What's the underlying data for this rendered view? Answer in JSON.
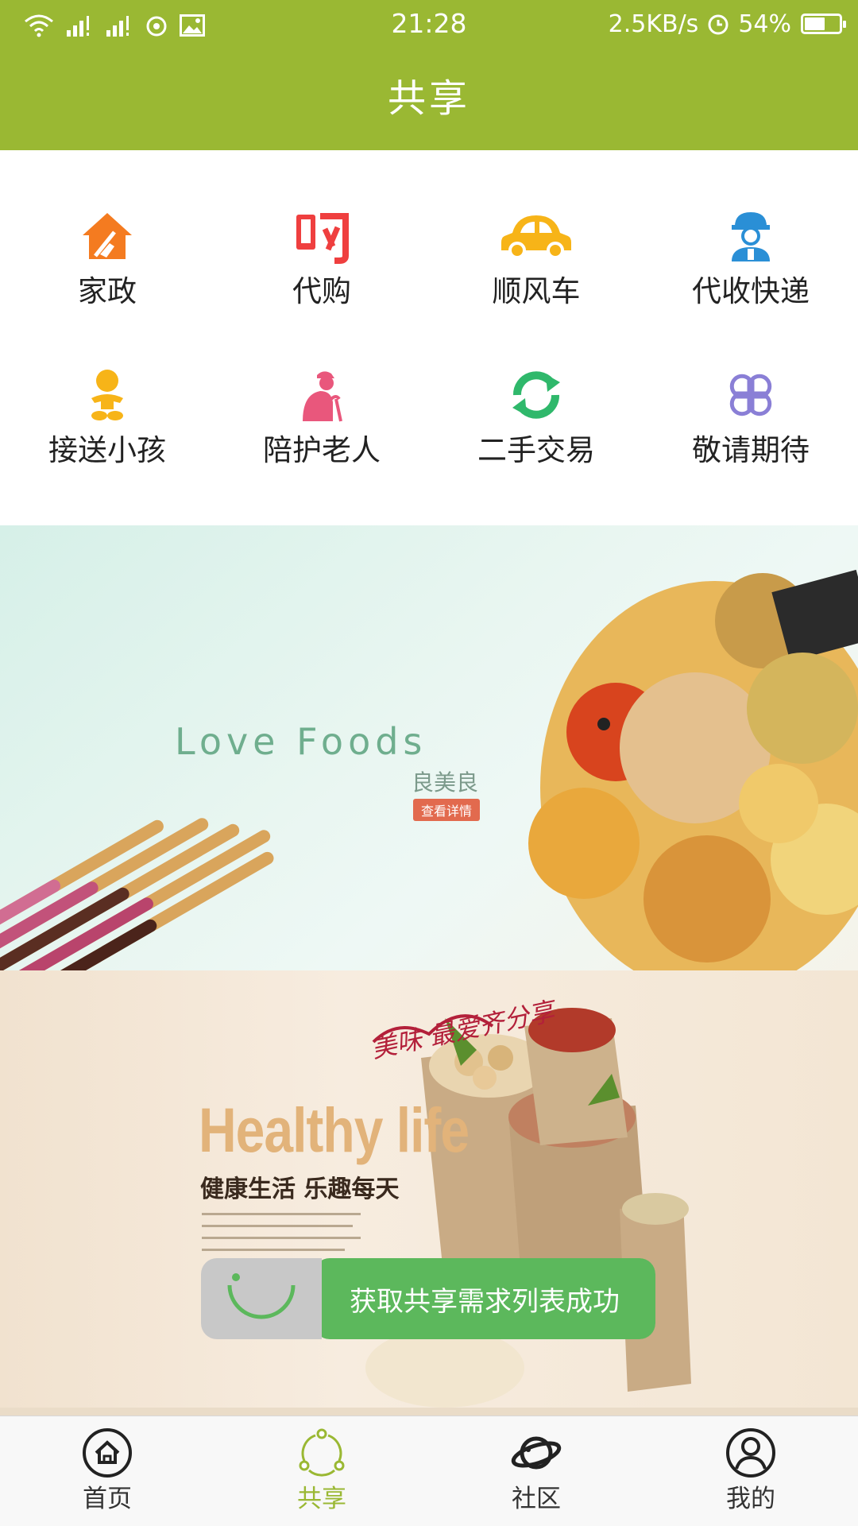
{
  "status_bar": {
    "time": "21:28",
    "net_speed": "2.5KB/s",
    "battery": "54%",
    "battery_level": 0.54,
    "icons": [
      "wifi-icon",
      "signal-icon",
      "signal-icon",
      "weibo-icon",
      "image-icon",
      "alarm-icon",
      "battery-icon"
    ]
  },
  "header": {
    "title": "共享"
  },
  "services": [
    {
      "label": "家政",
      "icon": "house-broom-icon",
      "color": "#f47b20"
    },
    {
      "label": "代购",
      "icon": "buy-char-icon",
      "color": "#ef3f3f"
    },
    {
      "label": "顺风车",
      "icon": "car-icon",
      "color": "#f7b418"
    },
    {
      "label": "代收快递",
      "icon": "courier-icon",
      "color": "#2a8fd6"
    },
    {
      "label": "接送小孩",
      "icon": "baby-icon",
      "color": "#f7b418"
    },
    {
      "label": "陪护老人",
      "icon": "elder-icon",
      "color": "#e9577c"
    },
    {
      "label": "二手交易",
      "icon": "recycle-icon",
      "color": "#2fb86b"
    },
    {
      "label": "敬请期待",
      "icon": "clover-icon",
      "color": "#8a7fd6"
    }
  ],
  "banners": [
    {
      "title": "Love Foods",
      "brand": "良美良",
      "button": "查看详情"
    },
    {
      "title": "Healthy life",
      "subtitle": "健康生活 乐趣每天",
      "slogan": "美味 最爱齐分享"
    }
  ],
  "toast": {
    "message": "获取共享需求列表成功"
  },
  "tabbar": {
    "items": [
      {
        "label": "首页",
        "icon": "home-icon"
      },
      {
        "label": "共享",
        "icon": "share-icon",
        "active": true
      },
      {
        "label": "社区",
        "icon": "planet-icon"
      },
      {
        "label": "我的",
        "icon": "user-icon"
      }
    ]
  },
  "colors": {
    "brand": "#9ab833",
    "toast": "#5cb85c"
  }
}
